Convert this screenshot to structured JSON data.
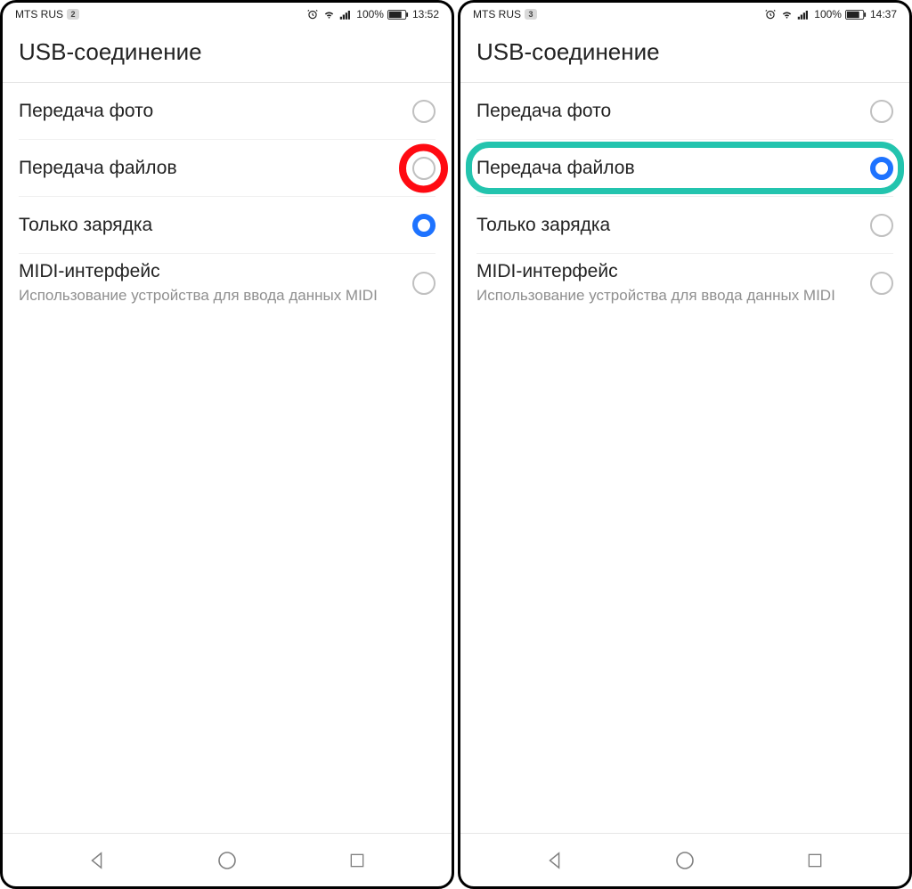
{
  "left": {
    "status": {
      "carrier": "MTS RUS",
      "sim_badge": "2",
      "battery": "100%",
      "time": "13:52"
    },
    "title": "USB-соединение",
    "options": [
      {
        "label": "Передача фото",
        "selected": false
      },
      {
        "label": "Передача файлов",
        "selected": false,
        "highlight": "ring"
      },
      {
        "label": "Только зарядка",
        "selected": true
      },
      {
        "label": "MIDI-интерфейс",
        "sub": "Использование устройства для ввода данных MIDI",
        "selected": false
      }
    ]
  },
  "right": {
    "status": {
      "carrier": "MTS RUS",
      "sim_badge": "3",
      "battery": "100%",
      "time": "14:37"
    },
    "title": "USB-соединение",
    "options": [
      {
        "label": "Передача фото",
        "selected": false
      },
      {
        "label": "Передача файлов",
        "selected": true,
        "highlight": "box"
      },
      {
        "label": "Только зарядка",
        "selected": false
      },
      {
        "label": "MIDI-интерфейс",
        "sub": "Использование устройства для ввода данных MIDI",
        "selected": false
      }
    ]
  },
  "colors": {
    "accent": "#1e73ff",
    "ring": "#ff0a12",
    "box": "#23c4ae"
  }
}
